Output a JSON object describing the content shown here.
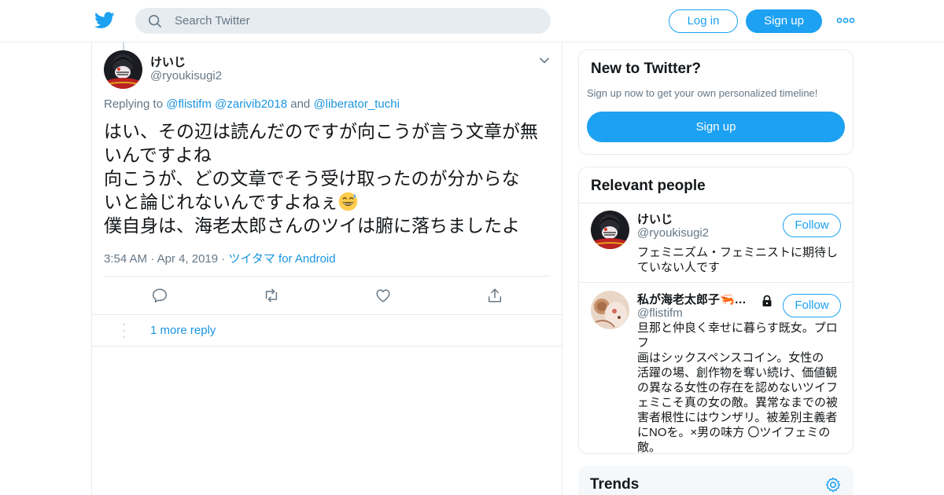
{
  "header": {
    "search_placeholder": "Search Twitter",
    "login_label": "Log in",
    "signup_label": "Sign up",
    "brand_color": "#1da1f2",
    "icons": {
      "logo": "twitter-bird-icon",
      "search": "search-icon",
      "more": "more-dots-icon"
    }
  },
  "tweet": {
    "author_name": "けいじ",
    "author_handle": "@ryoukisugi2",
    "replying_prefix": "Replying to",
    "reply_to_1": "@flistifm",
    "reply_to_2": "@zarivib2018",
    "reply_and": "and",
    "reply_to_3": "@liberator_tuchi",
    "text_lines": [
      "はい、その辺は読んだのですが向こうが言う文章が無",
      "いんですよね",
      "向こうが、どの文章でそう受け取ったのが分からな",
      "いと論じれないんですよねぇ",
      "僕自身は、海老太郎さんのツイは腑に落ちましたよ"
    ],
    "emoji": "grinning-sweat-emoji",
    "time": "3:54 AM",
    "date": "Apr 4, 2019",
    "source": "ツイタマ for Android",
    "actions": [
      "reply-icon",
      "retweet-icon",
      "like-icon",
      "share-icon"
    ]
  },
  "more_replies_label": "1 more reply",
  "sidebar": {
    "new_to_twitter": {
      "title": "New to Twitter?",
      "subtitle": "Sign up now to get your own personalized timeline!",
      "signup_label": "Sign up"
    },
    "relevant_people": {
      "title": "Relevant people",
      "people": [
        {
          "name": "けいじ",
          "handle": "@ryoukisugi2",
          "follow_label": "Follow",
          "bio_lines": [
            "フェミニズム・フェミニストに期待し",
            "ていない人です"
          ]
        },
        {
          "name": "私が海老太郎子🦐…",
          "handle": "@flistifm",
          "follow_label": "Follow",
          "protected": true,
          "bio_lines": [
            "旦那と仲良く幸せに暮らす既女。プロフ",
            "画はシックスペンスコイン。女性の",
            "活躍の場、創作物を奪い続け、価値観",
            "の異なる女性の存在を認めないツイフ",
            "ェミこそ真の女の敵。異常なまでの被",
            "害者根性にはウンザリ。被差別主義者",
            "にNOを。×男の味方 〇ツイフェミの",
            "敵。"
          ]
        }
      ]
    },
    "trends": {
      "title": "Trends"
    }
  }
}
